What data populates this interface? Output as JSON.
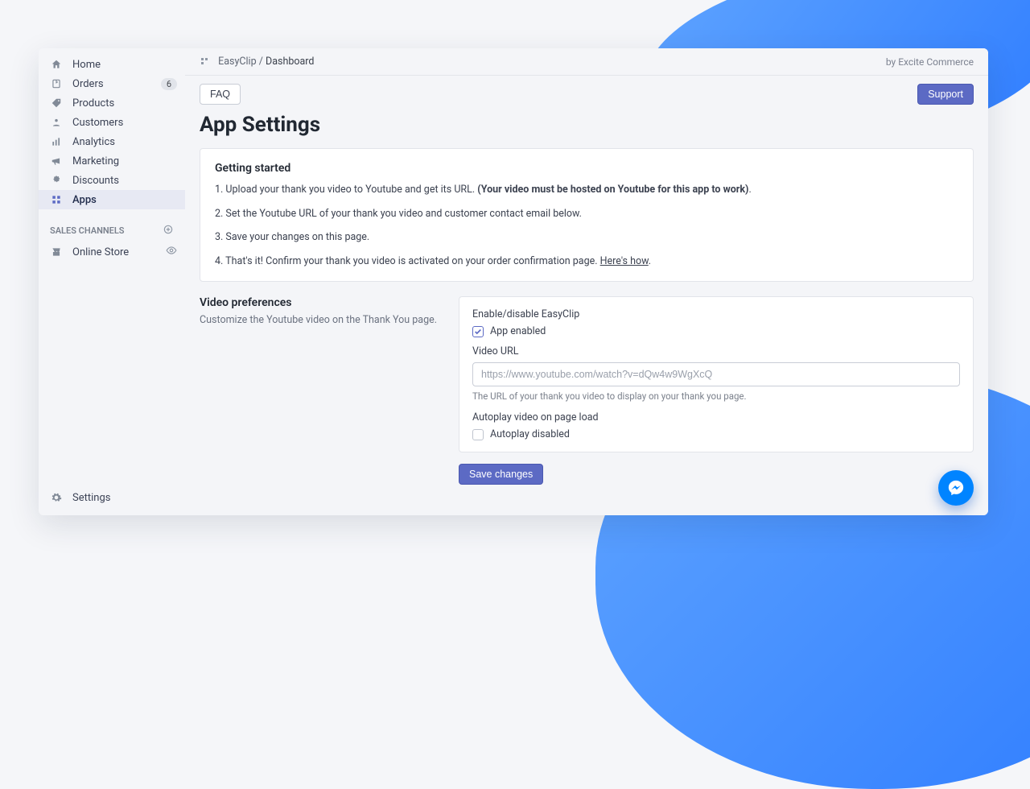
{
  "sidebar": {
    "items": [
      {
        "label": "Home"
      },
      {
        "label": "Orders",
        "badge": "6"
      },
      {
        "label": "Products"
      },
      {
        "label": "Customers"
      },
      {
        "label": "Analytics"
      },
      {
        "label": "Marketing"
      },
      {
        "label": "Discounts"
      },
      {
        "label": "Apps"
      }
    ],
    "section_label": "SALES CHANNELS",
    "channel_label": "Online Store",
    "settings_label": "Settings"
  },
  "breadcrumb": {
    "app": "EasyClip",
    "page": "Dashboard"
  },
  "attribution": "by Excite Commerce",
  "buttons": {
    "faq": "FAQ",
    "support": "Support",
    "save": "Save changes"
  },
  "page_title": "App Settings",
  "getting_started": {
    "heading": "Getting started",
    "step1_prefix": "1. Upload your thank you video to Youtube and get its URL. ",
    "step1_bold": "(Your video must be hosted on Youtube for this app to work)",
    "step1_suffix": ".",
    "step2": "2. Set the Youtube URL of your thank you video and customer contact email below.",
    "step3": "3. Save your changes on this page.",
    "step4_prefix": "4. That's it! Confirm your thank you video is activated on your order confirmation page. ",
    "step4_link": "Here's how",
    "step4_suffix": "."
  },
  "prefs": {
    "title": "Video preferences",
    "desc": "Customize the Youtube video on the Thank You page.",
    "enable_label": "Enable/disable EasyClip",
    "app_enabled_label": "App enabled",
    "video_url_label": "Video URL",
    "video_url_placeholder": "https://www.youtube.com/watch?v=dQw4w9WgXcQ",
    "video_url_help": "The URL of your thank you video to display on your thank you page.",
    "autoplay_label": "Autoplay video on page load",
    "autoplay_disabled_label": "Autoplay disabled"
  }
}
